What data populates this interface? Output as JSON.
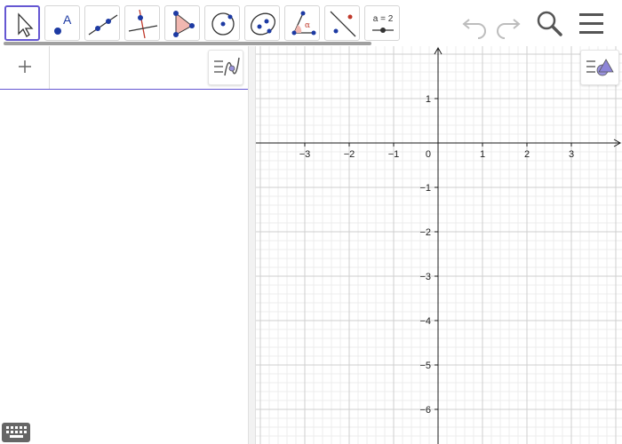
{
  "toolbar": {
    "tools": [
      {
        "name": "move-tool",
        "selected": true
      },
      {
        "name": "point-tool",
        "label": "A"
      },
      {
        "name": "line-tool"
      },
      {
        "name": "perpendicular-line-tool"
      },
      {
        "name": "polygon-tool"
      },
      {
        "name": "circle-center-point-tool"
      },
      {
        "name": "ellipse-tool"
      },
      {
        "name": "angle-tool",
        "label": "α"
      },
      {
        "name": "reflect-tool"
      },
      {
        "name": "slider-tool",
        "label": "a = 2"
      }
    ],
    "actions": [
      "undo",
      "redo",
      "search",
      "menu"
    ]
  },
  "algebra": {
    "add_label": "+",
    "input_value": ""
  },
  "graphics": {
    "x_axis": {
      "min": -4,
      "max": 4,
      "tick_labels": [
        "−3",
        "−2",
        "−1",
        "1",
        "2",
        "3"
      ]
    },
    "y_axis": {
      "min": -7,
      "max": 2,
      "tick_labels": [
        "1",
        "−1",
        "−2",
        "−3",
        "−4",
        "−5",
        "−6"
      ]
    },
    "origin_label": "0",
    "grid": true
  },
  "colors": {
    "accent": "#6557d2",
    "grid_major": "#cfcfcf",
    "grid_minor": "#ececec",
    "axis": "#1a1a1a",
    "tool_point": "#1d3aa3",
    "tool_red": "#c0392b",
    "polygon_fill": "#f1b7b0"
  }
}
